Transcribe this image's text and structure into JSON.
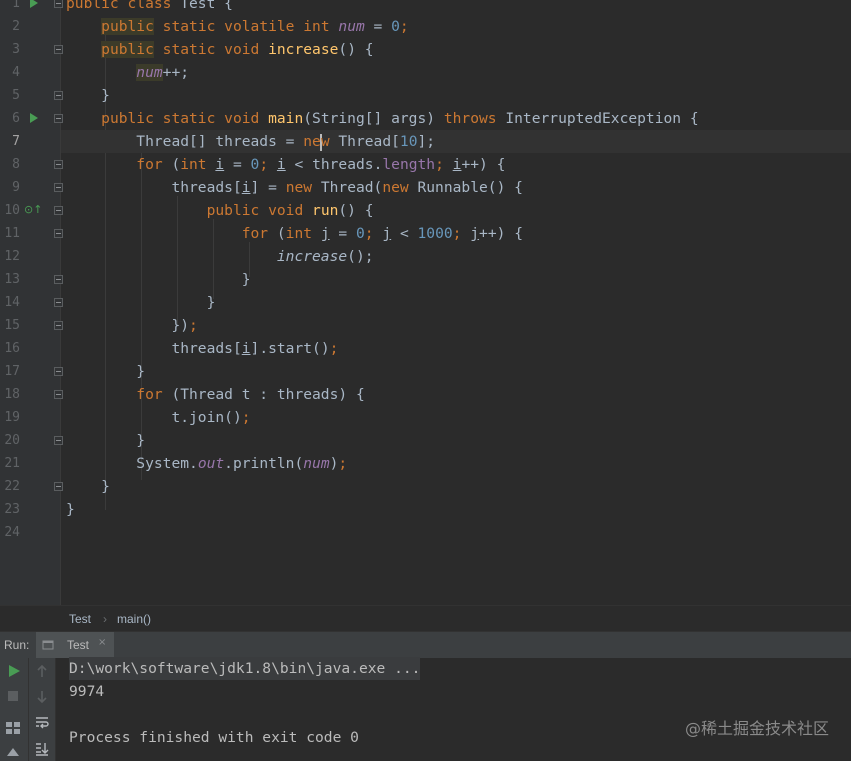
{
  "editor": {
    "line_numbers": [
      "1",
      "2",
      "3",
      "4",
      "5",
      "6",
      "7",
      "8",
      "9",
      "10",
      "11",
      "12",
      "13",
      "14",
      "15",
      "16",
      "17",
      "18",
      "19",
      "20",
      "21",
      "22",
      "23",
      "24"
    ]
  },
  "code": {
    "l1_kw": "public class",
    "l1_name": " Test {",
    "l2_kw1": "public",
    "l2_kw2": "static volatile int ",
    "l2_fld": "num",
    "l2_eq": " = ",
    "l2_num": "0",
    "l2_end": ";",
    "l3_kw1": "public",
    "l3_kw2": "static void ",
    "l3_meth": "increase",
    "l3_end": "() {",
    "l4_fld": "num",
    "l4_end": "++;",
    "l5": "}",
    "l6_kw": "public static void ",
    "l6_meth": "main",
    "l6_mid": "(String[] args) ",
    "l6_kw2": "throws",
    "l6_end": " InterruptedException {",
    "l7_a": "Thread[] threads = ",
    "l7_kw_a": "ne",
    "l7_kw_b": "w",
    "l7_b": " Thread[",
    "l7_num": "10",
    "l7_end": "];",
    "l8_kw": "for",
    "l8_a": " (",
    "l8_int": "int ",
    "l8_i": "i",
    "l8_b": " = ",
    "l8_num": "0",
    "l8_c": "; ",
    "l8_i2": "i",
    "l8_d": " < threads.",
    "l8_len": "length",
    "l8_e": "; ",
    "l8_i3": "i",
    "l8_f": "++) {",
    "l9_a": "threads[",
    "l9_i": "i",
    "l9_b": "] = ",
    "l9_new": "new",
    "l9_c": " Thread(",
    "l9_new2": "new",
    "l9_d": " Runnable() {",
    "l10_kw": "public void ",
    "l10_meth": "run",
    "l10_end": "() {",
    "l11_kw": "for",
    "l11_a": " (",
    "l11_int": "int ",
    "l11_j": "j",
    "l11_b": " = ",
    "l11_num": "0",
    "l11_c": "; ",
    "l11_j2": "j",
    "l11_d": " < ",
    "l11_num2": "1000",
    "l11_e": "; ",
    "l11_j3": "j",
    "l11_f": "++) {",
    "l12_meth": "increase",
    "l12_end": "();",
    "l13": "}",
    "l14": "}",
    "l15_a": "})",
    "l15_b": ";",
    "l16_a": "threads[",
    "l16_i": "i",
    "l16_b": "].start()",
    "l16_c": ";",
    "l17": "}",
    "l18_kw": "for",
    "l18_a": " (Thread t : threads) {",
    "l19_a": "t.join()",
    "l19_b": ";",
    "l20": "}",
    "l21_a": "System.",
    "l21_out": "out",
    "l21_b": ".println(",
    "l21_fld": "num",
    "l21_c": ")",
    "l21_d": ";",
    "l22": "}",
    "l23": "}"
  },
  "breadcrumb": {
    "class": "Test",
    "sep": "›",
    "method": "main()"
  },
  "run_panel": {
    "label": "Run:",
    "tab_title": "Test",
    "tab_close": "×"
  },
  "console": {
    "command": "D:\\work\\software\\jdk1.8\\bin\\java.exe ...",
    "output": "9974",
    "finish": "Process finished with exit code 0"
  },
  "watermark": "@稀土掘金技术社区",
  "colors": {
    "keyword": "#cc7832",
    "number": "#6897bb",
    "field": "#9876aa",
    "method": "#ffc66d",
    "text": "#a9b7c6",
    "run_green": "#499c54"
  }
}
